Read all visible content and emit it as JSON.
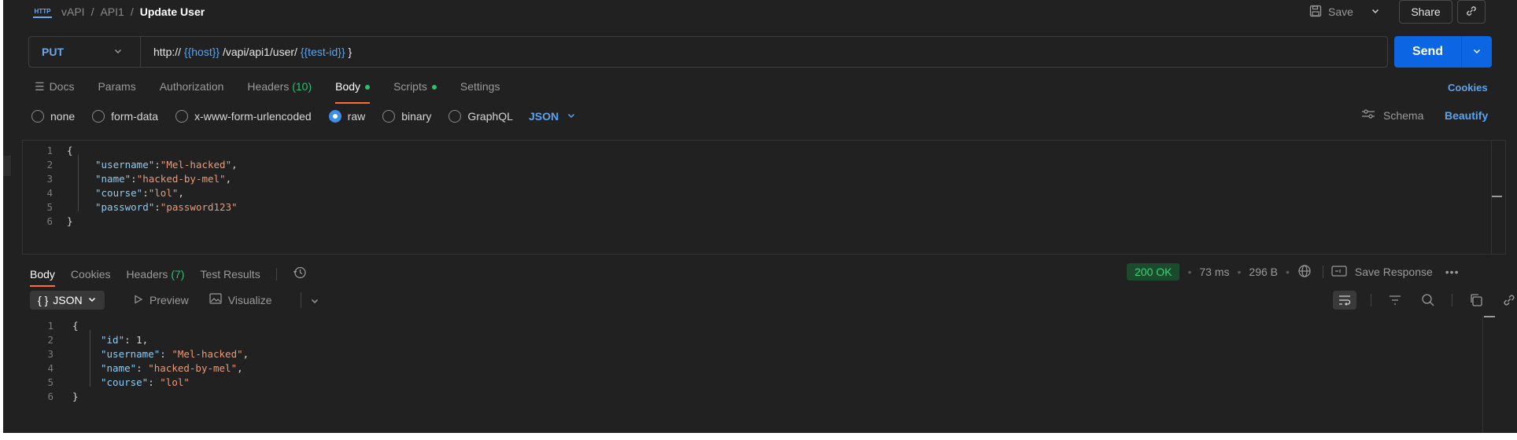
{
  "breadcrumb": {
    "icon": "http-icon",
    "workspace": "vAPI",
    "collection": "API1",
    "separator": "/",
    "request": "Update User"
  },
  "header_actions": {
    "save_label": "Save",
    "share_label": "Share"
  },
  "request": {
    "method": "PUT",
    "url_parts": [
      {
        "text": "http:// ",
        "type": "plain"
      },
      {
        "text": "{{host}}",
        "type": "var"
      },
      {
        "text": " /vapi/api1/user/ ",
        "type": "plain"
      },
      {
        "text": "{{test-id}}",
        "type": "var"
      },
      {
        "text": " }",
        "type": "plain"
      }
    ],
    "send_label": "Send"
  },
  "request_tabs": [
    {
      "label": "Docs",
      "icon": "doc-lines-icon"
    },
    {
      "label": "Params"
    },
    {
      "label": "Authorization"
    },
    {
      "label": "Headers",
      "count": "(10)"
    },
    {
      "label": "Body",
      "active": true,
      "dot": true
    },
    {
      "label": "Scripts",
      "dot": true
    },
    {
      "label": "Settings"
    }
  ],
  "cookies_label": "Cookies",
  "body_types": [
    {
      "label": "none",
      "selected": false
    },
    {
      "label": "form-data",
      "selected": false
    },
    {
      "label": "x-www-form-urlencoded",
      "selected": false
    },
    {
      "label": "raw",
      "selected": true
    },
    {
      "label": "binary",
      "selected": false
    },
    {
      "label": "GraphQL",
      "selected": false
    }
  ],
  "raw_format": "JSON",
  "schema_label": "Schema",
  "beautify_label": "Beautify",
  "request_body_lines": [
    {
      "n": "1",
      "tokens": [
        [
          "pun",
          "{"
        ]
      ]
    },
    {
      "n": "2",
      "tokens": [
        [
          "key",
          "\"username\""
        ],
        [
          "pun",
          ":"
        ],
        [
          "str",
          "\"Mel-hacked\""
        ],
        [
          "pun",
          ","
        ]
      ]
    },
    {
      "n": "3",
      "tokens": [
        [
          "key",
          "\"name\""
        ],
        [
          "pun",
          ":"
        ],
        [
          "str",
          "\"hacked-by-mel\""
        ],
        [
          "pun",
          ","
        ]
      ]
    },
    {
      "n": "4",
      "tokens": [
        [
          "key",
          "\"course\""
        ],
        [
          "pun",
          ":"
        ],
        [
          "str",
          "\"lol\""
        ],
        [
          "pun",
          ","
        ]
      ]
    },
    {
      "n": "5",
      "tokens": [
        [
          "key",
          "\"password\""
        ],
        [
          "pun",
          ":"
        ],
        [
          "str",
          "\"password123\""
        ]
      ]
    },
    {
      "n": "6",
      "tokens": [
        [
          "pun",
          "}"
        ]
      ]
    }
  ],
  "response_tabs": [
    {
      "label": "Body",
      "active": true
    },
    {
      "label": "Cookies"
    },
    {
      "label": "Headers",
      "count": "(7)"
    },
    {
      "label": "Test Results"
    }
  ],
  "response_meta": {
    "status": "200 OK",
    "time": "73 ms",
    "size": "296 B",
    "save_response_label": "Save Response"
  },
  "response_view": {
    "format_label": "JSON",
    "format_icon": "{ }",
    "preview_label": "Preview",
    "visualize_label": "Visualize"
  },
  "response_body_lines": [
    {
      "n": "1",
      "tokens": [
        [
          "pun",
          "{"
        ]
      ]
    },
    {
      "n": "2",
      "tokens": [
        [
          "key",
          "\"id\""
        ],
        [
          "pun",
          ": 1,"
        ]
      ]
    },
    {
      "n": "3",
      "tokens": [
        [
          "key",
          "\"username\""
        ],
        [
          "pun",
          ": "
        ],
        [
          "str",
          "\"Mel-hacked\""
        ],
        [
          "pun",
          ","
        ]
      ]
    },
    {
      "n": "4",
      "tokens": [
        [
          "key",
          "\"name\""
        ],
        [
          "pun",
          ": "
        ],
        [
          "str",
          "\"hacked-by-mel\""
        ],
        [
          "pun",
          ","
        ]
      ]
    },
    {
      "n": "5",
      "tokens": [
        [
          "key",
          "\"course\""
        ],
        [
          "pun",
          ": "
        ],
        [
          "str",
          "\"lol\""
        ]
      ]
    },
    {
      "n": "6",
      "tokens": [
        [
          "pun",
          "}"
        ]
      ]
    }
  ],
  "colors": {
    "accent_blue": "#0c66e4",
    "link_blue": "#5aa3f0",
    "active_tab_underline": "#ff6c37",
    "status_green": "#3dd17a"
  }
}
